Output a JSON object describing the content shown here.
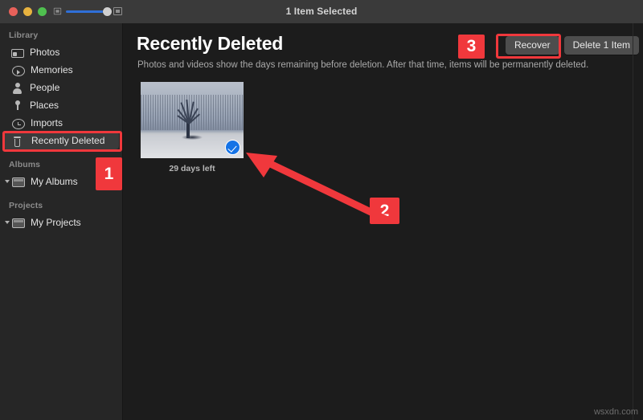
{
  "window": {
    "title": "1 Item Selected",
    "traffic_lights": [
      "close",
      "minimize",
      "maximize"
    ],
    "zoom_slider": {
      "small_icon": "small-thumbnail-icon",
      "large_icon": "large-thumbnail-icon",
      "value_percent": 72
    }
  },
  "sidebar": {
    "sections": [
      {
        "title": "Library",
        "items": [
          {
            "label": "Photos",
            "icon": "photos-icon",
            "selected": false
          },
          {
            "label": "Memories",
            "icon": "memories-icon",
            "selected": false
          },
          {
            "label": "People",
            "icon": "people-icon",
            "selected": false
          },
          {
            "label": "Places",
            "icon": "places-icon",
            "selected": false
          },
          {
            "label": "Imports",
            "icon": "imports-icon",
            "selected": false
          },
          {
            "label": "Recently Deleted",
            "icon": "trash-icon",
            "selected": true
          }
        ]
      },
      {
        "title": "Albums",
        "items": [
          {
            "label": "My Albums",
            "icon": "folder-icon",
            "selected": false,
            "disclosure": "expanded"
          }
        ]
      },
      {
        "title": "Projects",
        "items": [
          {
            "label": "My Projects",
            "icon": "folder-icon",
            "selected": false,
            "disclosure": "expanded"
          }
        ]
      }
    ]
  },
  "main": {
    "title": "Recently Deleted",
    "subtitle": "Photos and videos show the days remaining before deletion. After that time, items will be permanently deleted.",
    "actions": {
      "recover_label": "Recover",
      "delete_label": "Delete 1 Item"
    },
    "photos": [
      {
        "caption": "29 days left",
        "selected": true,
        "description": "winter-tree-snow-photo"
      }
    ]
  },
  "annotations": {
    "step1": "1",
    "step2": "2",
    "step3": "3",
    "accent_color": "#f0383c",
    "arrow": "arrow-pointing-to-selection-checkmark"
  },
  "watermark": "wsxdn.com"
}
